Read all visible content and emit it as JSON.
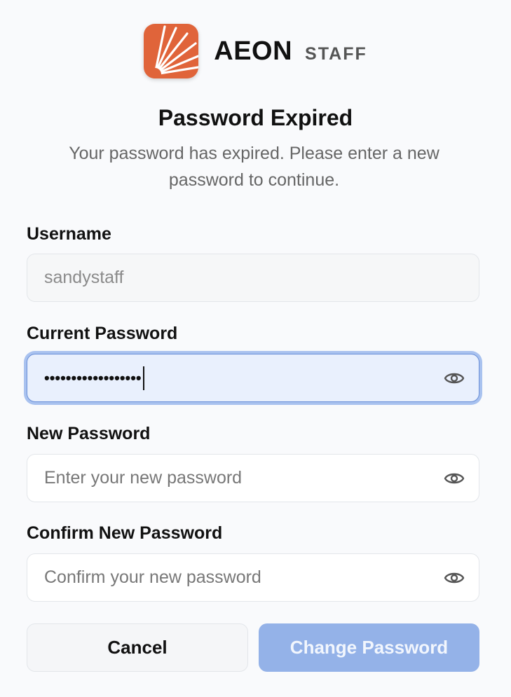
{
  "brand": {
    "name": "AEON",
    "sub": "STAFF",
    "logo_icon": "sunburst-logo-icon",
    "accent_color": "#e0643a"
  },
  "header": {
    "title": "Password Expired",
    "subtitle": "Your password has expired. Please enter a new password to continue."
  },
  "form": {
    "username": {
      "label": "Username",
      "value": "sandystaff"
    },
    "current_password": {
      "label": "Current Password",
      "masked_value": "••••••••••••••••••",
      "toggle_icon": "eye-icon"
    },
    "new_password": {
      "label": "New Password",
      "placeholder": "Enter your new password",
      "toggle_icon": "eye-icon"
    },
    "confirm_password": {
      "label": "Confirm New Password",
      "placeholder": "Confirm your new password",
      "toggle_icon": "eye-icon"
    }
  },
  "actions": {
    "cancel_label": "Cancel",
    "submit_label": "Change Password",
    "submit_color": "#94b2e8"
  }
}
